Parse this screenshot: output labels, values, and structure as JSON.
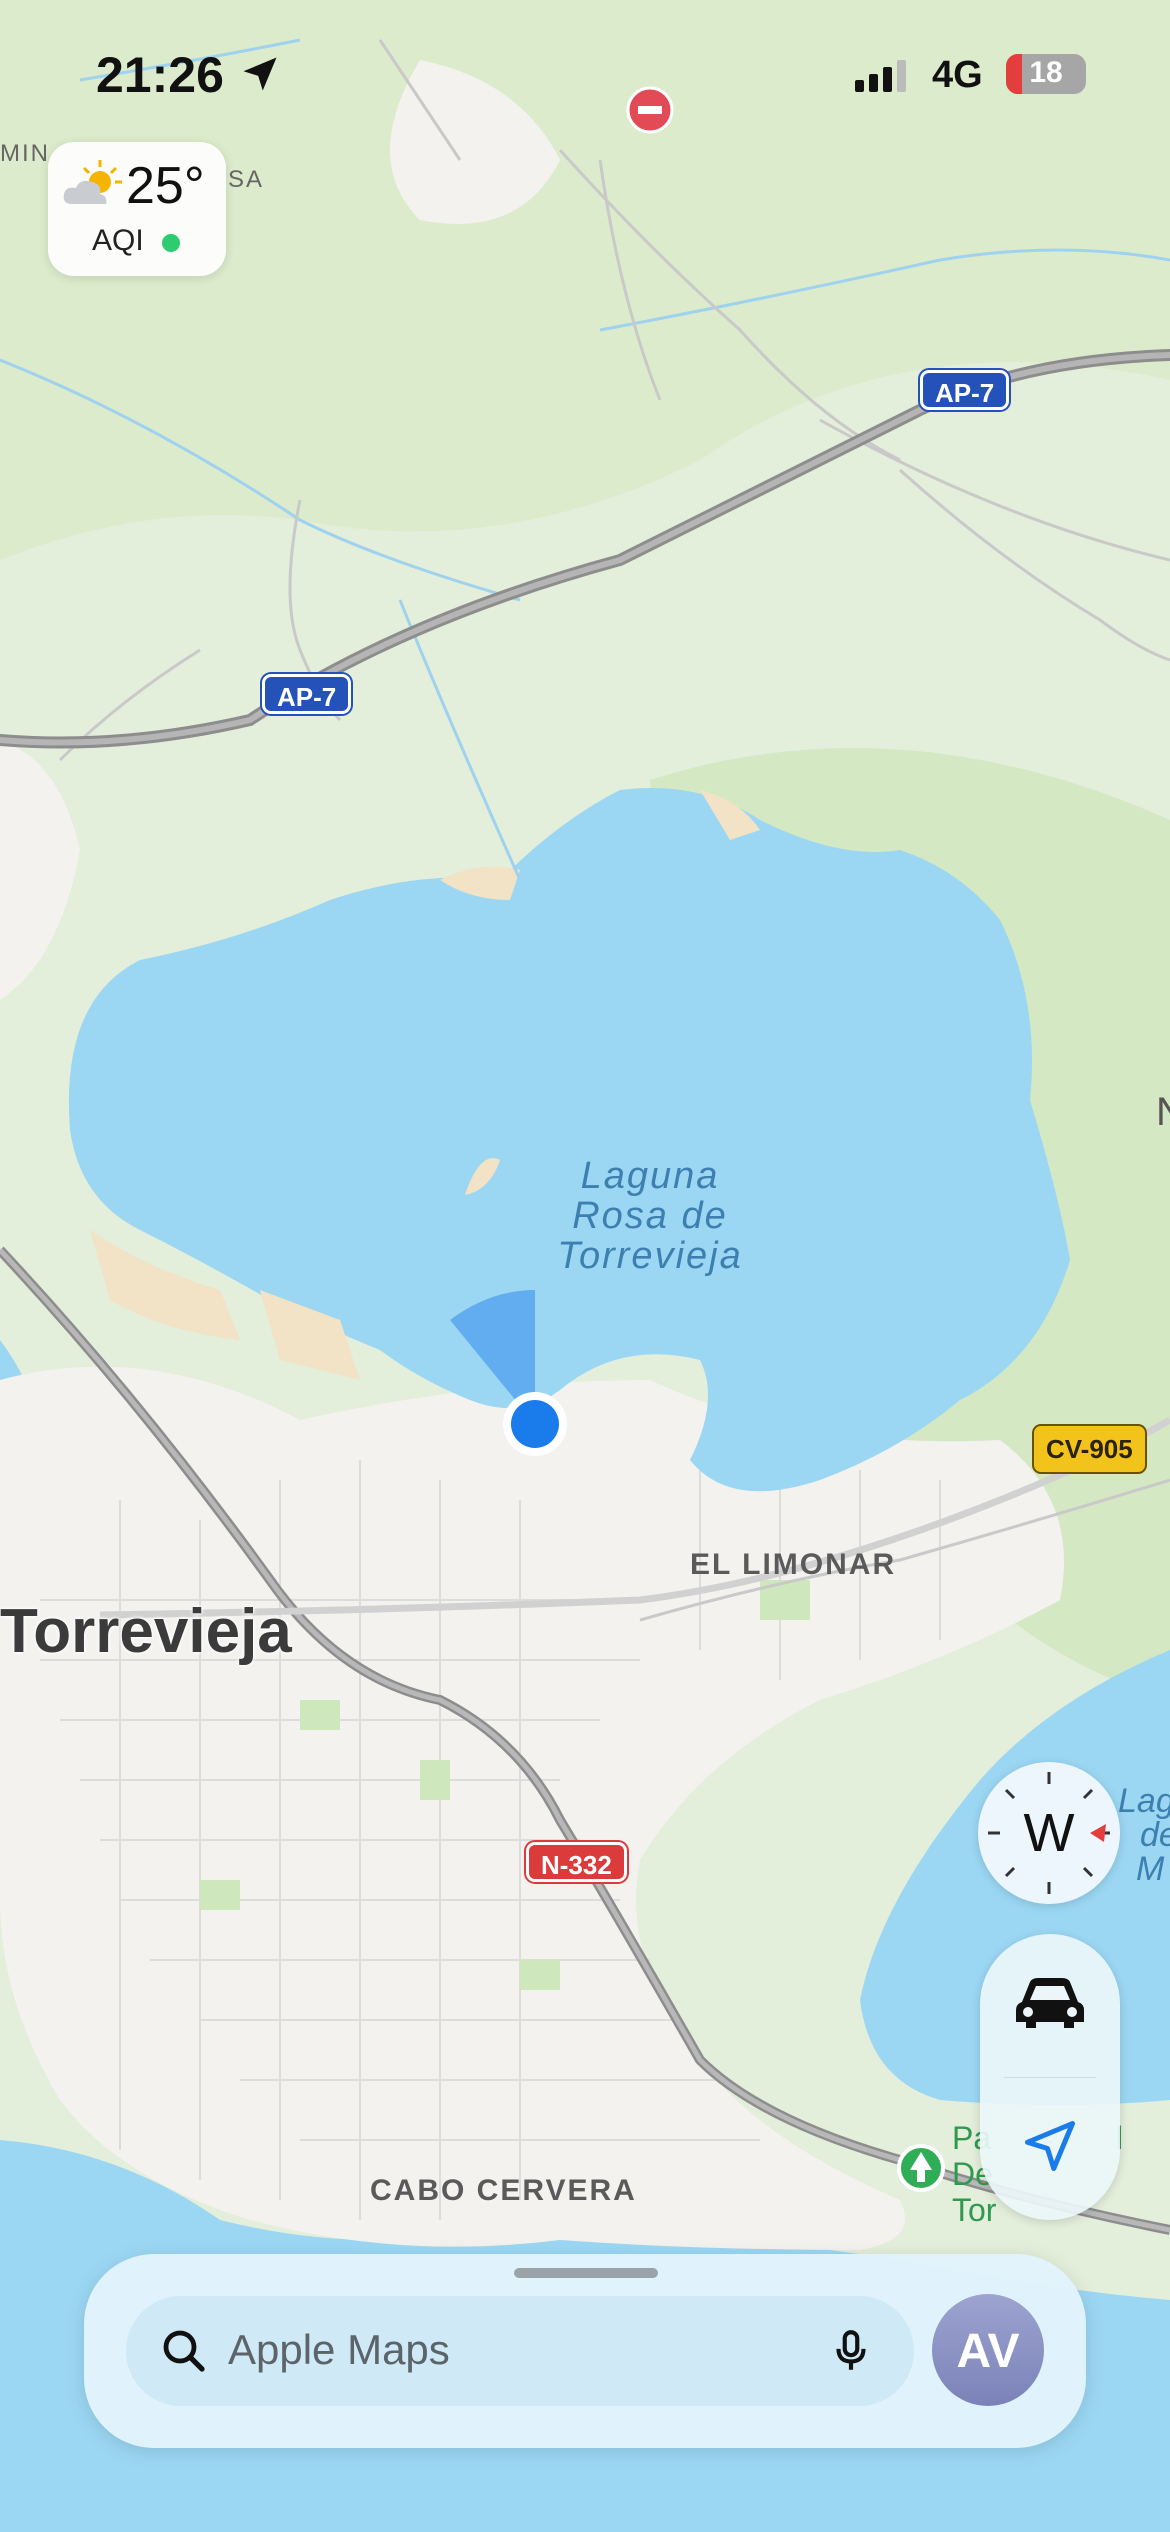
{
  "status_bar": {
    "time": "21:26",
    "network": "4G",
    "battery": "18"
  },
  "weather": {
    "temperature": "25°",
    "aqi_label": "AQI",
    "aqi_color": "#2ecc71"
  },
  "map": {
    "lake_label_lines": [
      "Laguna",
      "Rosa de",
      "Torrevieja"
    ],
    "city_label": "Torrevieja",
    "district_el_limonar": "EL LIMONAR",
    "district_cabo_cervera": "CABO CERVERA",
    "road_ap7_top": "AP-7",
    "road_ap7_left": "AP-7",
    "road_cv905": "CV-905",
    "road_n332": "N-332",
    "edge_label_top": "MIN",
    "edge_label_sa": "SA",
    "edge_label_right": "N",
    "edge_label_lag": [
      "Lag",
      "de",
      "M"
    ],
    "park_label": [
      "Pa",
      "De",
      "Tor"
    ],
    "park_label_right": "l"
  },
  "compass": {
    "heading": "W"
  },
  "controls": {
    "drive_icon": "car-icon",
    "location_icon": "location-arrow-icon"
  },
  "search": {
    "placeholder": "Apple Maps",
    "avatar_initials": "AV"
  },
  "colors": {
    "water": "#9bd7f3",
    "land": "#e3eedb",
    "urban": "#f3f2ef",
    "accent_blue": "#1a7bea"
  }
}
